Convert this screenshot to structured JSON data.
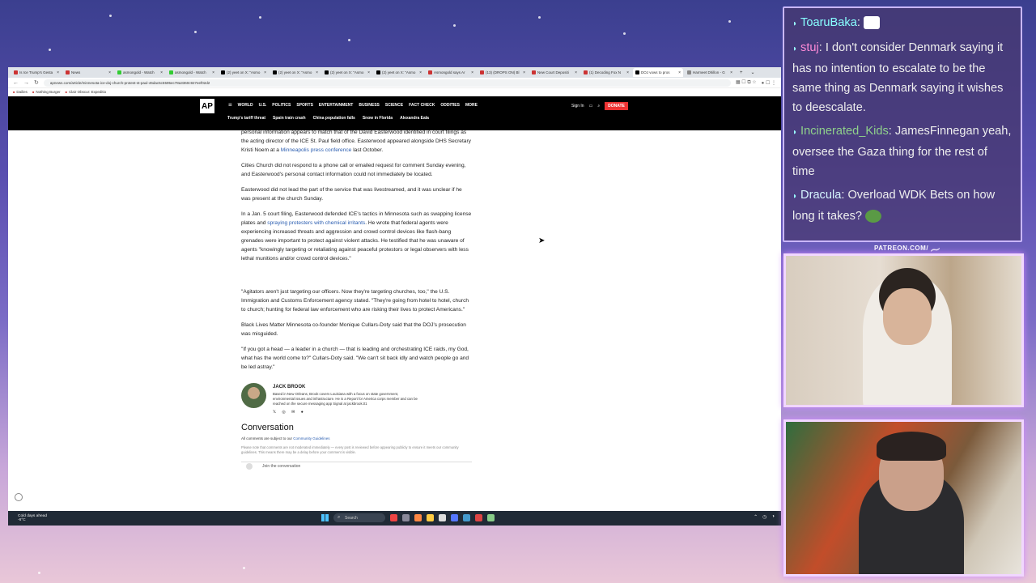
{
  "browser": {
    "tabs": [
      "Is Ice Trump's Gesta",
      "News",
      "asmongold - Watch",
      "asmongold - Watch",
      "(2) yeet on X: \"Asmo",
      "(2) yeet on X: \"Asmo",
      "(2) yeet on X: \"Asmo",
      "(2) yeet on X: \"Asmo",
      "Asmongold says Ar",
      "(13) (DROPS ON) Bl",
      "New Court Depositi",
      "(1) Decoding Fox N",
      "DOJ vows to pros",
      "Harmeet Dhillon - G"
    ],
    "url": "apnews.com/article/minnesota-ice-doj-church-protest-st-paul-46dac5c5595ec78a3360c927eef02d2",
    "bookmarks": [
      "Dailies",
      "Nothing Burger",
      "Clair Obscur: Expeditio"
    ]
  },
  "ap": {
    "logo": "AP",
    "nav": [
      "WORLD",
      "U.S.",
      "POLITICS",
      "SPORTS",
      "ENTERTAINMENT",
      "BUSINESS",
      "SCIENCE",
      "FACT CHECK",
      "ODDITIES",
      "MORE"
    ],
    "signin": "Sign In",
    "donate": "DONATE",
    "trending": [
      "Trump's tariff threat",
      "Spain train crash",
      "China population falls",
      "Snow in Florida",
      "Alexandra Eala"
    ]
  },
  "article": {
    "p1a": "personal information appears to match that of the David Easterwood identified in court filings as the acting director of the ICE St. Paul field office. Easterwood appeared alongside DHS Secretary Kristi Noem at a ",
    "p1link": "Minneapolis press conference",
    "p1b": " last October.",
    "p2": "Cities Church did not respond to a phone call or emailed request for comment Sunday evening, and Easterwood's personal contact information could not immediately be located.",
    "p3": "Easterwood did not lead the part of the service that was livestreamed, and it was unclear if he was present at the church Sunday.",
    "p4a": "In a Jan. 5 court filing, Easterwood defended ICE's tactics in Minnesota such as swapping license plates and ",
    "p4link": "spraying protesters with chemical irritants",
    "p4b": ". He wrote that federal agents were experiencing increased threats and aggression and crowd control devices like flash-bang grenades were important to protect against violent attacks. He testified that he was unaware of agents \"knowingly targeting or retaliating against peaceful protestors or legal observers with less lethal munitions and/or crowd control devices.\"",
    "p5": "\"Agitators aren't just targeting our officers. Now they're targeting churches, too,\" the U.S. Immigration and Customs Enforcement agency stated. \"They're going from hotel to hotel, church to church; hunting for federal law enforcement who are risking their lives to protect Americans.\"",
    "p6": "Black Lives Matter Minnesota co-founder Monique Cullars-Doty said that the DOJ's prosecution was misguided.",
    "p7": "\"If you got a head — a leader in a church — that is leading and orchestrating ICE raids, my God, what has the world come to?\" Cullars-Doty said. \"We can't sit back idly and watch people go and be led astray.\"",
    "author_name": "JACK BROOK",
    "author_bio": "Based in New Orleans, Brook covers Louisiana with a focus on state government, environmental issues and infrastructure. He is a Report for America corps member and can be reached on the secure messaging app Signal at jackbrook.01",
    "conv_title": "Conversation",
    "conv_sub_a": "All comments are subject to our ",
    "conv_sub_link": "Community Guidelines",
    "conv_note": "Please note that comments are not moderated immediately — every post is reviewed before appearing publicly to ensure it meets our community guidelines. This means there may be a delay before your comment is visible.",
    "join": "Join the conversation"
  },
  "taskbar": {
    "weather_title": "Cold days ahead",
    "weather_temp": "-6°C",
    "search": "Search"
  },
  "chat": {
    "messages": [
      {
        "user": "ToaruBaka",
        "text": ""
      },
      {
        "user": "stuj",
        "text": ": I don't consider Denmark saying it has no intention to escalate to be the same thing as Denmark saying it wishes to deescalate."
      },
      {
        "user": "Incinerated_Kids",
        "text": ": JamesFinnegan yeah, oversee the Gaza thing for the rest of time"
      },
      {
        "user": "Dracula",
        "text": ": Overload WDK Bets on how long it takes?"
      }
    ]
  },
  "overlay": {
    "patreon": "PATREON.COM/"
  }
}
